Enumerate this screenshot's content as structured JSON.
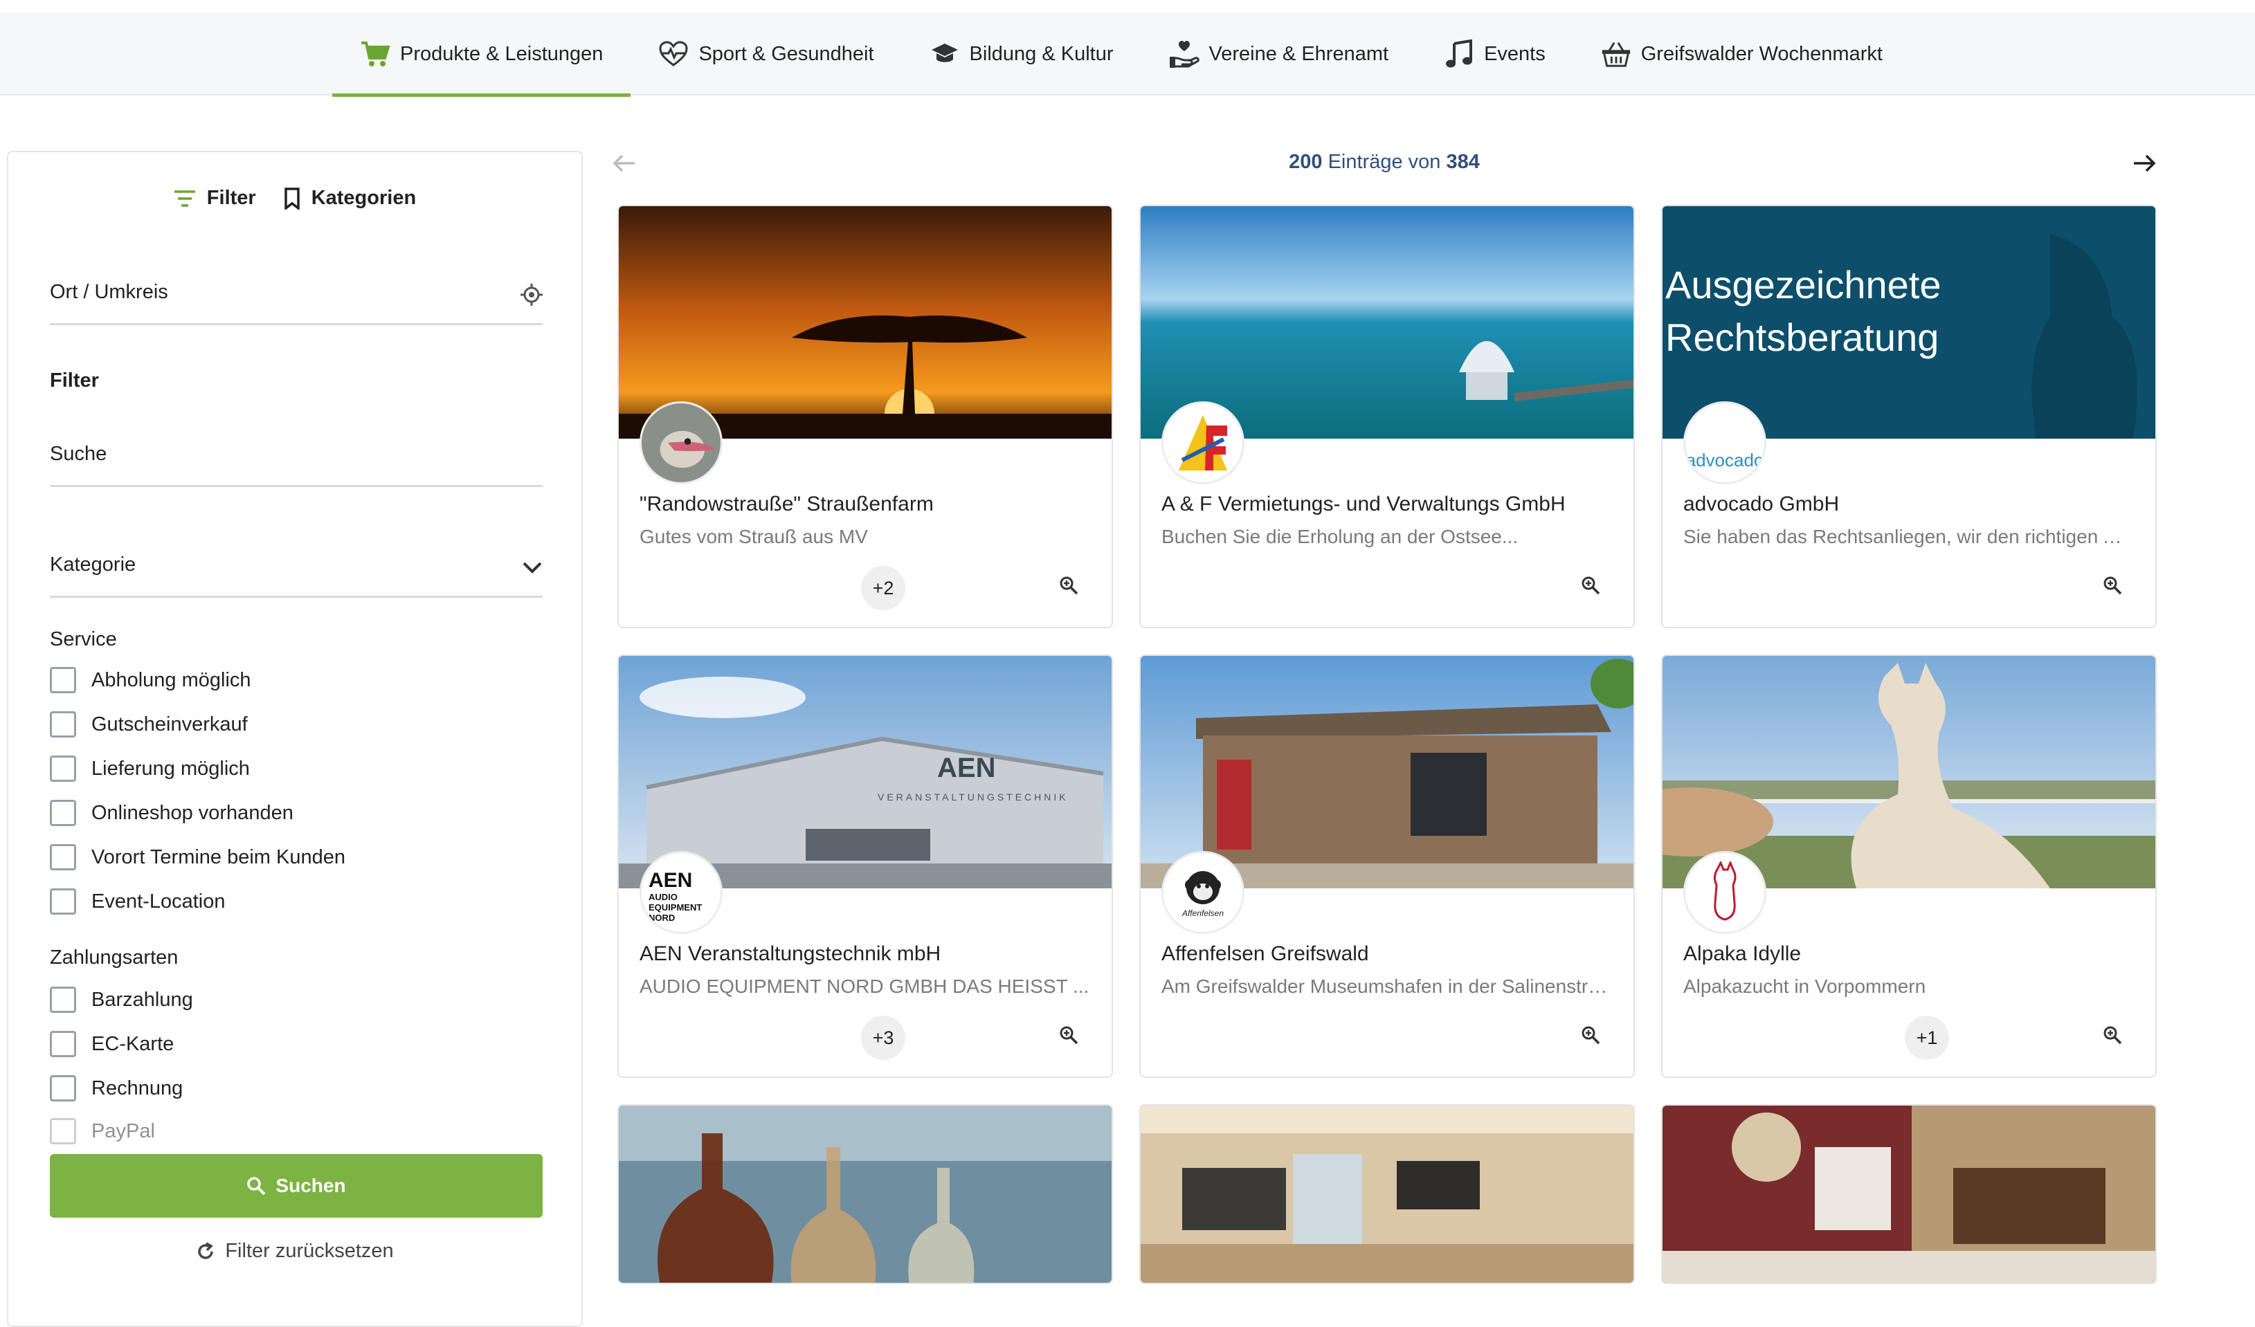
{
  "nav": {
    "items": [
      {
        "label": "Produkte & Leistungen",
        "icon": "cart-icon",
        "active": true
      },
      {
        "label": "Sport & Gesundheit",
        "icon": "heart-pulse-icon",
        "active": false
      },
      {
        "label": "Bildung & Kultur",
        "icon": "graduation-cap-icon",
        "active": false
      },
      {
        "label": "Vereine & Ehrenamt",
        "icon": "hand-heart-icon",
        "active": false
      },
      {
        "label": "Events",
        "icon": "music-note-icon",
        "active": false
      },
      {
        "label": "Greifswalder Wochenmarkt",
        "icon": "basket-icon",
        "active": false
      }
    ]
  },
  "sidebar": {
    "tabs": {
      "filter": "Filter",
      "kategorien": "Kategorien"
    },
    "location_label": "Ort / Umkreis",
    "filter_heading": "Filter",
    "search_label": "Suche",
    "category_label": "Kategorie",
    "service_heading": "Service",
    "service_options": [
      "Abholung möglich",
      "Gutscheinverkauf",
      "Lieferung möglich",
      "Onlineshop vorhanden",
      "Vorort Termine beim Kunden",
      "Event-Location"
    ],
    "payment_heading": "Zahlungsarten",
    "payment_options": [
      "Barzahlung",
      "EC-Karte",
      "Rechnung",
      "PayPal"
    ],
    "search_button": "Suchen",
    "reset_link": "Filter zurücksetzen"
  },
  "results": {
    "shown": "200",
    "middle": "Einträge von",
    "total": "384"
  },
  "cards": [
    {
      "title": "\"Randowstraußе\" Straußenfarm",
      "subtitle": "Gutes vom Strauß aus MV",
      "more": "+2"
    },
    {
      "title": "A & F Vermietungs- und Verwaltungs GmbH",
      "subtitle": "Buchen Sie die Erholung an der Ostsee...",
      "more": ""
    },
    {
      "title": "advocado GmbH",
      "subtitle": "Sie haben das Rechtsanliegen, wir den richtigen Anwalt",
      "more": "",
      "banner_line1": "Ausgezeichnete",
      "banner_line2": "Rechtsberatung",
      "logo": "advocado"
    },
    {
      "title": "AEN Veranstaltungstechnik mbH",
      "subtitle": "AUDIO EQUIPMENT NORD GMBH DAS HEISST ...",
      "more": "+3",
      "logo_big": "AEN",
      "logo_small1": "AUDIO",
      "logo_small2": "EQUIPMENT",
      "logo_small3": "NORD",
      "building_text": "AEN",
      "building_sub": "VERANSTALTUNGSTECHNIK"
    },
    {
      "title": "Affenfelsen Greifswald",
      "subtitle": "Am Greifswalder Museumshafen in der Salinenstraße",
      "more": "",
      "logo": "Affenfelsen"
    },
    {
      "title": "Alpaka Idylle",
      "subtitle": "Alpakazucht in Vorpommern",
      "more": "+1"
    }
  ]
}
